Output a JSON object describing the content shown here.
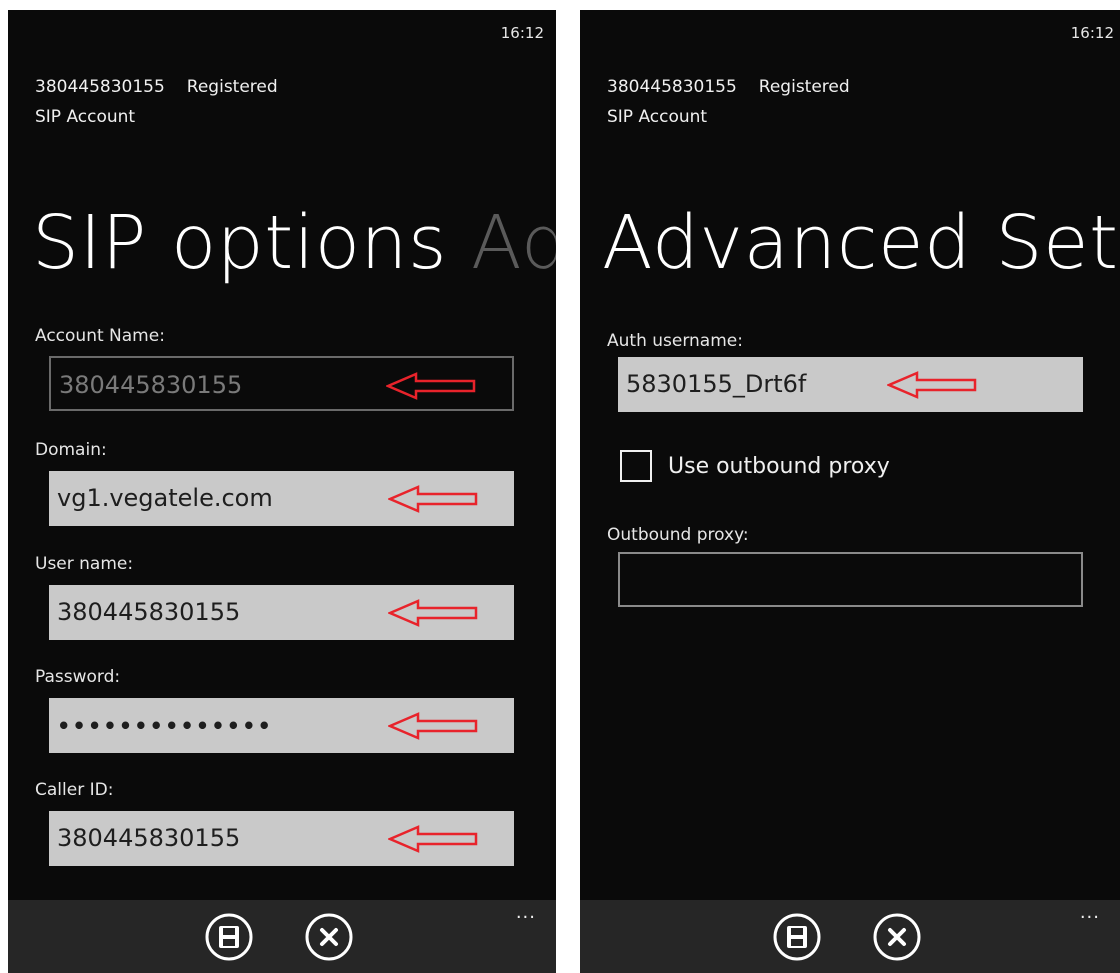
{
  "colors": {
    "background": "#0a0a0a",
    "field_fill": "#c9c9c9",
    "annotation_arrow": "#e8232b",
    "appbar": "#262626"
  },
  "left_screen": {
    "time": "16:12",
    "account_number": "380445830155",
    "registration_status": "Registered",
    "account_type": "SIP Account",
    "pivot_current": "SIP options",
    "pivot_next": "Adv",
    "fields": [
      {
        "label": "Account Name:",
        "value": "380445830155",
        "state": "disabled"
      },
      {
        "label": "Domain:",
        "value": "vg1.vegatele.com",
        "state": "normal"
      },
      {
        "label": "User name:",
        "value": "380445830155",
        "state": "normal"
      },
      {
        "label": "Password:",
        "value": "••••••••••••••",
        "state": "password"
      },
      {
        "label": "Caller ID:",
        "value": "380445830155",
        "state": "normal"
      }
    ],
    "appbar": {
      "save_icon": "save-icon",
      "cancel_icon": "cancel-icon",
      "more": "..."
    }
  },
  "right_screen": {
    "time": "16:12",
    "account_number": "380445830155",
    "registration_status": "Registered",
    "account_type": "SIP Account",
    "pivot_current": "Advanced Setti",
    "auth_username_label": "Auth username:",
    "auth_username_value": "5830155_Drt6f",
    "use_outbound_proxy_label": "Use outbound proxy",
    "use_outbound_proxy_checked": false,
    "outbound_proxy_label": "Outbound proxy:",
    "outbound_proxy_value": "",
    "appbar": {
      "save_icon": "save-icon",
      "cancel_icon": "cancel-icon",
      "more": "..."
    }
  }
}
